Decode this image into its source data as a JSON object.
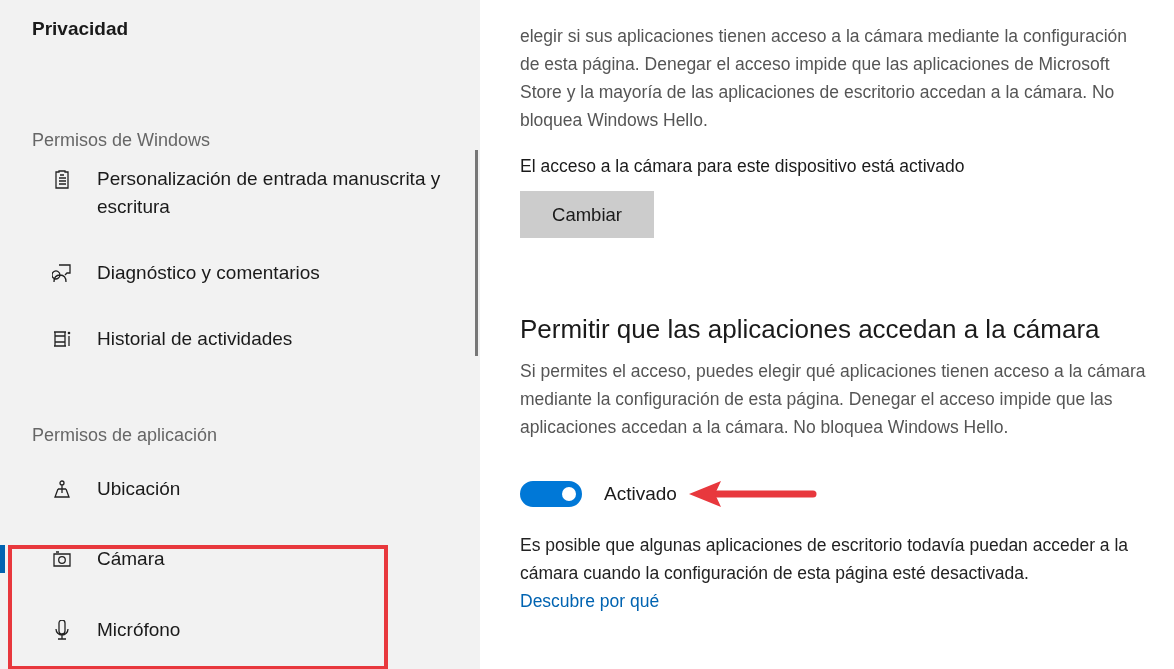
{
  "sidebar": {
    "title": "Privacidad",
    "sections": [
      {
        "heading": "Permisos de Windows",
        "items": [
          {
            "label": "Personalización de entrada manuscrita y escritura",
            "selected": false
          },
          {
            "label": "Diagnóstico y comentarios",
            "selected": false
          },
          {
            "label": "Historial de actividades",
            "selected": false
          }
        ]
      },
      {
        "heading": "Permisos de aplicación",
        "items": [
          {
            "label": "Ubicación",
            "selected": false
          },
          {
            "label": "Cámara",
            "selected": true
          },
          {
            "label": "Micrófono",
            "selected": false
          }
        ]
      }
    ]
  },
  "device_access": {
    "description": "elegir si sus aplicaciones tienen acceso a la cámara mediante la configuración de esta página. Denegar el acceso impide que las aplicaciones de Microsoft Store y la mayoría de las aplicaciones de escritorio accedan a la cámara. No bloquea Windows Hello.",
    "status": "El acceso a la cámara para este dispositivo está activado",
    "button": "Cambiar"
  },
  "app_access": {
    "heading": "Permitir que las aplicaciones accedan a la cámara",
    "description": "Si permites el acceso, puedes elegir qué aplicaciones tienen acceso a la cámara mediante la configuración de esta página. Denegar el acceso impide que las aplicaciones accedan a la cámara. No bloquea Windows Hello.",
    "toggle": {
      "on": true,
      "label": "Activado"
    },
    "note": "Es posible que algunas aplicaciones de escritorio todavía puedan acceder a la cámara cuando la configuración de esta página esté desactivada.",
    "link": "Descubre por qué"
  }
}
